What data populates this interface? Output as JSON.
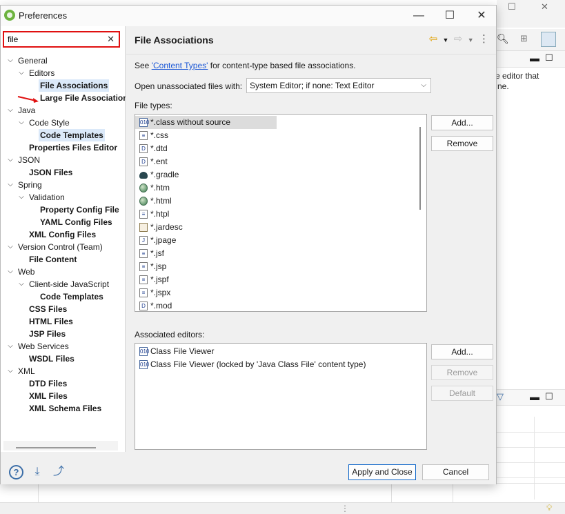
{
  "background": {
    "snippet_line1": "e editor that",
    "snippet_line2": "ne."
  },
  "window": {
    "title": "Preferences",
    "minimize": "—",
    "maximize": "☐",
    "close": "✕"
  },
  "filter": {
    "value": "file",
    "clear": "✕"
  },
  "tree": [
    {
      "label": "General",
      "level": 0,
      "twisty": "open",
      "bold": false,
      "selected": false
    },
    {
      "label": "Editors",
      "level": 1,
      "twisty": "open",
      "bold": false,
      "selected": false
    },
    {
      "label": "File Associations",
      "level": 2,
      "twisty": "none",
      "bold": true,
      "selected": true
    },
    {
      "label": "Large File Associations",
      "level": 2,
      "twisty": "none",
      "bold": true,
      "selected": false
    },
    {
      "label": "Java",
      "level": 0,
      "twisty": "open",
      "bold": false,
      "selected": false
    },
    {
      "label": "Code Style",
      "level": 1,
      "twisty": "open",
      "bold": false,
      "selected": false
    },
    {
      "label": "Code Templates",
      "level": 2,
      "twisty": "none",
      "bold": true,
      "selected": false,
      "highlight": true
    },
    {
      "label": "Properties Files Editor",
      "level": 1,
      "twisty": "none",
      "bold": true,
      "selected": false
    },
    {
      "label": "JSON",
      "level": 0,
      "twisty": "open",
      "bold": false,
      "selected": false
    },
    {
      "label": "JSON Files",
      "level": 1,
      "twisty": "none",
      "bold": true,
      "selected": false
    },
    {
      "label": "Spring",
      "level": 0,
      "twisty": "open",
      "bold": false,
      "selected": false
    },
    {
      "label": "Validation",
      "level": 1,
      "twisty": "open",
      "bold": false,
      "selected": false
    },
    {
      "label": "Property Config File",
      "level": 2,
      "twisty": "none",
      "bold": true,
      "selected": false
    },
    {
      "label": "YAML Config Files",
      "level": 2,
      "twisty": "none",
      "bold": true,
      "selected": false
    },
    {
      "label": "XML Config Files",
      "level": 1,
      "twisty": "none",
      "bold": true,
      "selected": false
    },
    {
      "label": "Version Control (Team)",
      "level": 0,
      "twisty": "open",
      "bold": false,
      "selected": false
    },
    {
      "label": "File Content",
      "level": 1,
      "twisty": "none",
      "bold": true,
      "selected": false
    },
    {
      "label": "Web",
      "level": 0,
      "twisty": "open",
      "bold": false,
      "selected": false
    },
    {
      "label": "Client-side JavaScript",
      "level": 1,
      "twisty": "open",
      "bold": false,
      "selected": false
    },
    {
      "label": "Code Templates",
      "level": 2,
      "twisty": "none",
      "bold": true,
      "selected": false
    },
    {
      "label": "CSS Files",
      "level": 1,
      "twisty": "none",
      "bold": true,
      "selected": false
    },
    {
      "label": "HTML Files",
      "level": 1,
      "twisty": "none",
      "bold": true,
      "selected": false
    },
    {
      "label": "JSP Files",
      "level": 1,
      "twisty": "none",
      "bold": true,
      "selected": false
    },
    {
      "label": "Web Services",
      "level": 0,
      "twisty": "open",
      "bold": false,
      "selected": false
    },
    {
      "label": "WSDL Files",
      "level": 1,
      "twisty": "none",
      "bold": true,
      "selected": false
    },
    {
      "label": "XML",
      "level": 0,
      "twisty": "open",
      "bold": false,
      "selected": false
    },
    {
      "label": "DTD Files",
      "level": 1,
      "twisty": "none",
      "bold": true,
      "selected": false
    },
    {
      "label": "XML Files",
      "level": 1,
      "twisty": "none",
      "bold": true,
      "selected": false
    },
    {
      "label": "XML Schema Files",
      "level": 1,
      "twisty": "none",
      "bold": true,
      "selected": false
    }
  ],
  "page": {
    "title": "File Associations",
    "see_prefix": "See ",
    "see_link": "'Content Types'",
    "see_suffix": " for content-type based file associations.",
    "open_label": "Open unassociated files with:",
    "open_value": "System Editor; if none: Text Editor",
    "file_types_label": "File types:",
    "associated_label": "Associated editors:"
  },
  "file_types": [
    {
      "name": "*.class without source",
      "icon": "class-file-icon",
      "glyph": "010",
      "selected": true
    },
    {
      "name": "*.css",
      "icon": "text-file-icon",
      "glyph": "≡",
      "selected": false
    },
    {
      "name": "*.dtd",
      "icon": "dtd-file-icon",
      "glyph": "D",
      "selected": false
    },
    {
      "name": "*.ent",
      "icon": "dtd-file-icon",
      "glyph": "D",
      "selected": false
    },
    {
      "name": "*.gradle",
      "icon": "gradle-icon",
      "glyph": "",
      "selected": false
    },
    {
      "name": "*.htm",
      "icon": "globe-icon",
      "glyph": "",
      "selected": false
    },
    {
      "name": "*.html",
      "icon": "globe-icon",
      "glyph": "",
      "selected": false
    },
    {
      "name": "*.htpl",
      "icon": "text-file-icon",
      "glyph": "≡",
      "selected": false
    },
    {
      "name": "*.jardesc",
      "icon": "jar-desc-icon",
      "glyph": "",
      "selected": false
    },
    {
      "name": "*.jpage",
      "icon": "jpage-file-icon",
      "glyph": "J",
      "selected": false
    },
    {
      "name": "*.jsf",
      "icon": "text-file-icon",
      "glyph": "≡",
      "selected": false
    },
    {
      "name": "*.jsp",
      "icon": "text-file-icon",
      "glyph": "≡",
      "selected": false
    },
    {
      "name": "*.jspf",
      "icon": "text-file-icon",
      "glyph": "≡",
      "selected": false
    },
    {
      "name": "*.jspx",
      "icon": "text-file-icon",
      "glyph": "≡",
      "selected": false
    },
    {
      "name": "*.mod",
      "icon": "dtd-file-icon",
      "glyph": "D",
      "selected": false
    }
  ],
  "associated_editors": [
    {
      "name": "Class File Viewer",
      "icon": "class-file-icon",
      "glyph": "010"
    },
    {
      "name": "Class File Viewer (locked by 'Java Class File' content type)",
      "icon": "class-file-icon",
      "glyph": "010"
    }
  ],
  "buttons": {
    "add_type": "Add...",
    "remove_type": "Remove",
    "add_editor": "Add...",
    "remove_editor": "Remove",
    "default_editor": "Default",
    "apply_close": "Apply and Close",
    "cancel": "Cancel",
    "help": "?"
  },
  "colors": {
    "accent": "#0a64c8",
    "filter_highlight": "#e01010",
    "link": "#1b57d6",
    "selection": "#dbe9f9"
  }
}
